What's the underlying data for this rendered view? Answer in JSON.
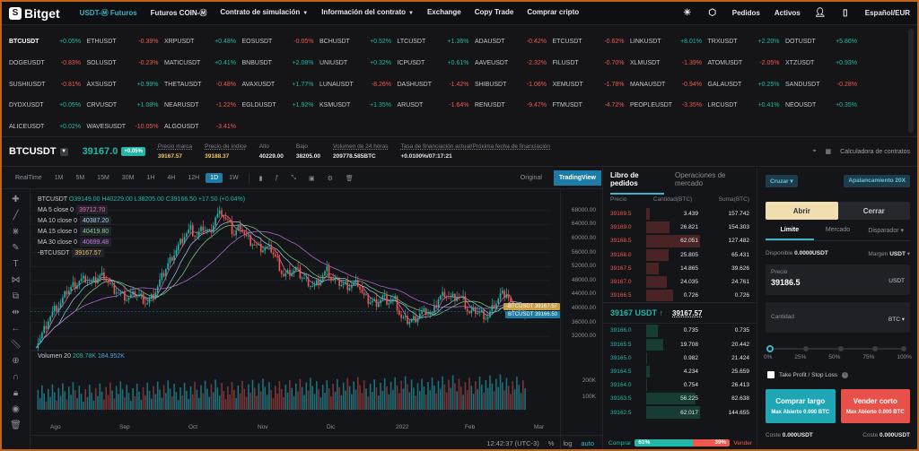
{
  "header": {
    "logo": "Bitget",
    "nav": [
      {
        "label": "USDT-Ⓜ Futuros",
        "active": true,
        "caret": false
      },
      {
        "label": "Futuros COIN-Ⓜ",
        "active": false,
        "caret": false
      },
      {
        "label": "Contrato de simulación",
        "active": false,
        "caret": true
      },
      {
        "label": "Información del contrato",
        "active": false,
        "caret": true
      },
      {
        "label": "Exchange",
        "active": false,
        "caret": false
      },
      {
        "label": "Copy Trade",
        "active": false,
        "caret": false
      },
      {
        "label": "Comprar cripto",
        "active": false,
        "caret": false
      }
    ],
    "orders": "Pedidos",
    "assets": "Activos",
    "locale": "Español/EUR"
  },
  "tickers": [
    [
      [
        "BTCUSDT",
        "+0.05%"
      ],
      [
        "ETHUSDT",
        "-0.39%"
      ],
      [
        "XRPUSDT",
        "+0.48%"
      ],
      [
        "EOSUSDT",
        "-0.05%"
      ],
      [
        "BCHUSDT",
        "+0.52%"
      ],
      [
        "LTCUSDT",
        "+1.36%"
      ],
      [
        "ADAUSDT",
        "-0.42%"
      ],
      [
        "ETCUSDT",
        "-0.62%"
      ],
      [
        "LINKUSDT",
        "+8.01%"
      ],
      [
        "TRXUSDT",
        "+2.20%"
      ],
      [
        "DOTUSDT",
        "+5.86%"
      ]
    ],
    [
      [
        "DOGEUSDT",
        "-0.83%"
      ],
      [
        "SOLUSDT",
        "-0.23%"
      ],
      [
        "MATICUSDT",
        "+0.41%"
      ],
      [
        "BNBUSDT",
        "+2.08%"
      ],
      [
        "UNIUSDT",
        "+0.32%"
      ],
      [
        "ICPUSDT",
        "+0.61%"
      ],
      [
        "AAVEUSDT",
        "-2.32%"
      ],
      [
        "FILUSDT",
        "-0.70%"
      ],
      [
        "XLMUSDT",
        "-1.39%"
      ],
      [
        "ATOMUSDT",
        "-2.05%"
      ],
      [
        "XTZUSDT",
        "+0.93%"
      ]
    ],
    [
      [
        "SUSHIUSDT",
        "-0.81%"
      ],
      [
        "AXSUSDT",
        "+0.99%"
      ],
      [
        "THETAUSDT",
        "-0.48%"
      ],
      [
        "AVAXUSDT",
        "+1.77%"
      ],
      [
        "LUNAUSDT",
        "-8.26%"
      ],
      [
        "DASHUSDT",
        "-1.42%"
      ],
      [
        "SHIBUSDT",
        "-1.06%"
      ],
      [
        "XEMUSDT",
        "-1.78%"
      ],
      [
        "MANAUSDT",
        "-0.94%"
      ],
      [
        "GALAUSDT",
        "+0.25%"
      ],
      [
        "SANDUSDT",
        "-0.28%"
      ]
    ],
    [
      [
        "DYDXUSDT",
        "+0.05%"
      ],
      [
        "CRVUSDT",
        "+1.08%"
      ],
      [
        "NEARUSDT",
        "-1.22%"
      ],
      [
        "EGLDUSDT",
        "+1.92%"
      ],
      [
        "KSMUSDT",
        "+1.35%"
      ],
      [
        "ARUSDT",
        "-1.64%"
      ],
      [
        "RENUSDT",
        "-9.47%"
      ],
      [
        "FTMUSDT",
        "-4.72%"
      ],
      [
        "PEOPLEUSDT",
        "-3.35%"
      ],
      [
        "LRCUSDT",
        "+0.41%"
      ],
      [
        "NEOUSDT",
        "+0.35%"
      ]
    ],
    [
      [
        "ALICEUSDT",
        "+0.02%"
      ],
      [
        "WAVESUSDT",
        "-10.05%"
      ],
      [
        "ALGOUSDT",
        "-3.41%"
      ]
    ]
  ],
  "instrument": {
    "symbol": "BTCUSDT",
    "last": "39167.0",
    "change": "+0.05%",
    "stats": [
      {
        "label": "Precio marca",
        "value": "39167.57",
        "yellow": true
      },
      {
        "label": "Precio de índice",
        "value": "39188.37",
        "yellow": true
      },
      {
        "label": "Alto",
        "value": "40229.00",
        "yellow": false
      },
      {
        "label": "Bajo",
        "value": "38205.00",
        "yellow": false
      },
      {
        "label": "Volumen de 24 horas",
        "value": "209778.585BTC",
        "yellow": false
      },
      {
        "label": "Tasa de financiación actual/Próxima fecha de financiación",
        "value": "+0.0100%/07:17:21",
        "yellow": false
      }
    ],
    "calc": "Calculadora de contratos"
  },
  "chart_toolbar": {
    "realtime": "RealTime",
    "intervals": [
      "1M",
      "5M",
      "15M",
      "30M",
      "1H",
      "4H",
      "12H",
      "1D",
      "1W"
    ],
    "active_interval": "1D",
    "original": "Original",
    "tradingview": "TradingView"
  },
  "legend": {
    "symbol_line": "BTCUSDT",
    "ohlc": "O39149.00 H40229.00 L38205.00 C39166.50 +17.50 (+0.04%)",
    "ma": [
      {
        "label": "MA 5 close 0",
        "value": "39712.70",
        "color": "#e86ab0"
      },
      {
        "label": "MA 10 close 0",
        "value": "40387.20",
        "color": "#9ad0f0"
      },
      {
        "label": "MA 15 close 0",
        "value": "40419.80",
        "color": "#7fd18a"
      },
      {
        "label": "MA 30 close 0",
        "value": "40699.48",
        "color": "#c070e0"
      },
      {
        "label": "-BTCUSDT",
        "value": "39167.57",
        "color": "#f0c860"
      }
    ],
    "volume_label": "Volumen 20",
    "vol1": "209.78K",
    "vol2": "184.952K"
  },
  "chart_data": {
    "type": "candlestick",
    "x_ticks": [
      "Ago",
      "Sep",
      "Oct",
      "Nov",
      "Dic",
      "2022",
      "Feb",
      "Mar"
    ],
    "y_ticks": [
      68000,
      64000,
      60000,
      56000,
      52000,
      48000,
      44000,
      40000,
      36000,
      32000
    ],
    "ylim": [
      30000,
      70000
    ],
    "close_series": [
      30000,
      32500,
      36800,
      39500,
      41200,
      44800,
      46500,
      47800,
      48500,
      47000,
      48900,
      49800,
      46500,
      45000,
      43500,
      42800,
      44000,
      43200,
      41500,
      43800,
      47500,
      51500,
      55000,
      57800,
      61000,
      62500,
      60300,
      63000,
      61500,
      66000,
      67500,
      64500,
      61200,
      63800,
      60200,
      58800,
      57200,
      57000,
      56800,
      53500,
      49200,
      50300,
      51000,
      48900,
      47600,
      46200,
      48800,
      50800,
      47800,
      47200,
      46500,
      46700,
      47300,
      43100,
      42000,
      41800,
      43200,
      42000,
      42200,
      37000,
      36300,
      36800,
      38500,
      39200,
      38000,
      42800,
      44500,
      42700,
      43800,
      42200,
      38400,
      39200,
      38500,
      37500,
      41200,
      43500,
      44300,
      39500,
      39000,
      39170
    ],
    "vol_max_label": "200K",
    "vol_mid_label": "100K",
    "price_tags": [
      {
        "label": "-BTCUSDT",
        "value": "39167.57",
        "color": "#c8a24a"
      },
      {
        "label": "BTCUSDT",
        "value": "39166.50",
        "color": "#1d7ca5"
      }
    ]
  },
  "chart_footer": {
    "time": "12:42:37 (UTC-3)",
    "pct": "%",
    "log": "log",
    "auto": "auto"
  },
  "orderbook": {
    "tabs": [
      "Libro de pedidos",
      "Operaciones de mercado"
    ],
    "headers": [
      "Precio",
      "Cantidad(BTC)",
      "Suma(BTC)"
    ],
    "asks": [
      [
        "39169.5",
        "3.439",
        "157.742",
        0.06
      ],
      [
        "39169.0",
        "26.821",
        "154.303",
        0.43
      ],
      [
        "39168.5",
        "62.051",
        "127.482",
        1.0
      ],
      [
        "39168.0",
        "25.805",
        "65.431",
        0.42
      ],
      [
        "39167.5",
        "14.865",
        "39.626",
        0.24
      ],
      [
        "39167.0",
        "24.035",
        "24.761",
        0.39
      ],
      [
        "39166.5",
        "0.726",
        "0.726",
        0.5
      ]
    ],
    "mid_price": "39167 USDT ↑",
    "mark": "39167.57",
    "bids": [
      [
        "39166.0",
        "0.735",
        "0.735",
        0.22
      ],
      [
        "39165.5",
        "19.708",
        "20.442",
        0.32
      ],
      [
        "39165.0",
        "0.982",
        "21.424",
        0.02
      ],
      [
        "39164.5",
        "4.234",
        "25.659",
        0.07
      ],
      [
        "39164.0",
        "0.754",
        "26.413",
        0.01
      ],
      [
        "39163.5",
        "56.225",
        "82.638",
        0.91
      ],
      [
        "39162.5",
        "62.017",
        "144.655",
        1.0
      ]
    ],
    "buy_label": "Comprar",
    "buy_pct": "61%",
    "sell_pct": "39%",
    "sell_label": "Vender",
    "buy_ratio": 0.61
  },
  "order_panel": {
    "margin_mode": "Cruzar",
    "leverage": "Apalancamiento 20X",
    "open": "Abrir",
    "close": "Cerrar",
    "types": [
      "Límite",
      "Mercado",
      "Disparador"
    ],
    "available_label": "Disponible",
    "available_value": "0.0000USDT",
    "margin_label": "Margen",
    "margin_unit": "USDT",
    "price_label": "Precio",
    "price_value": "39186.5",
    "price_unit": "USDT",
    "qty_label": "Cantidad",
    "qty_unit": "BTC",
    "slider_ticks": [
      "0%",
      "25%",
      "50%",
      "75%",
      "100%"
    ],
    "slider_level": 0,
    "tpsl": "Take Profit / Stop Loss",
    "long": "Comprar largo",
    "long_max": "Max Abierto 0.000 BTC",
    "short": "Vender corto",
    "short_max": "Max Abierto 0.000 BTC",
    "cost_label": "Coste",
    "cost_value": "0.000USDT"
  }
}
